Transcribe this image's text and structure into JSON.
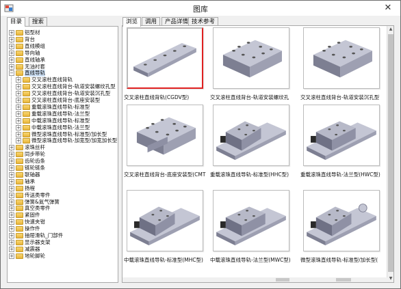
{
  "window": {
    "title": "图库"
  },
  "left_panel": {
    "tabs": [
      {
        "label": "目录",
        "active": true
      },
      {
        "label": "搜索",
        "active": false
      }
    ],
    "tree": [
      {
        "label": "铝型材",
        "level": 0,
        "expanded": false
      },
      {
        "label": "背台",
        "level": 0,
        "expanded": false
      },
      {
        "label": "直线模组",
        "level": 0,
        "expanded": false
      },
      {
        "label": "导向轴",
        "level": 0,
        "expanded": false
      },
      {
        "label": "直线轴承",
        "level": 0,
        "expanded": false
      },
      {
        "label": "无油衬套",
        "level": 0,
        "expanded": false
      },
      {
        "label": "直线导轨",
        "level": 0,
        "expanded": true
      },
      {
        "label": "交叉滚柱直线背轨",
        "level": 1,
        "expanded": false
      },
      {
        "label": "交叉滚柱直线背台-轨道安装螺纹孔型",
        "level": 1,
        "expanded": false
      },
      {
        "label": "交叉滚柱直线背台-轨道安装沉孔型",
        "level": 1,
        "expanded": false
      },
      {
        "label": "交叉滚柱直线背台-底座安装型",
        "level": 1,
        "expanded": false
      },
      {
        "label": "重载滚珠直线导轨-标准型",
        "level": 1,
        "expanded": false
      },
      {
        "label": "重载滚珠直线导轨-法兰型",
        "level": 1,
        "expanded": false
      },
      {
        "label": "中载滚珠直线导轨-标准型",
        "level": 1,
        "expanded": false
      },
      {
        "label": "中载滚珠直线导轨-法兰型",
        "level": 1,
        "expanded": false
      },
      {
        "label": "微型滚珠直线导轨-标准型/加长型",
        "level": 1,
        "expanded": false
      },
      {
        "label": "微型滚珠直线导轨-加宽型/加宽加长型",
        "level": 1,
        "expanded": false
      },
      {
        "label": "滚珠丝杆",
        "level": 0,
        "expanded": false
      },
      {
        "label": "同步带轮",
        "level": 0,
        "expanded": false
      },
      {
        "label": "齿轮齿条",
        "level": 0,
        "expanded": false
      },
      {
        "label": "链轮链条",
        "level": 0,
        "expanded": false
      },
      {
        "label": "联轴器",
        "level": 0,
        "expanded": false
      },
      {
        "label": "轴承",
        "level": 0,
        "expanded": false
      },
      {
        "label": "扬程",
        "level": 0,
        "expanded": false
      },
      {
        "label": "传送类零件",
        "level": 0,
        "expanded": false
      },
      {
        "label": "弹簧&氮气弹簧",
        "level": 0,
        "expanded": false
      },
      {
        "label": "真空类零件",
        "level": 0,
        "expanded": false
      },
      {
        "label": "紧固件",
        "level": 0,
        "expanded": false
      },
      {
        "label": "快速夹钳",
        "level": 0,
        "expanded": false
      },
      {
        "label": "操作件",
        "level": 0,
        "expanded": false
      },
      {
        "label": "抽屉滑轨_门部件",
        "level": 0,
        "expanded": false
      },
      {
        "label": "显示器支架",
        "level": 0,
        "expanded": false
      },
      {
        "label": "减震器",
        "level": 0,
        "expanded": false
      },
      {
        "label": "地轮脚轮",
        "level": 0,
        "expanded": false
      }
    ]
  },
  "right_panel": {
    "tabs": [
      {
        "label": "浏览",
        "active": true
      },
      {
        "label": "调用",
        "active": false
      },
      {
        "label": "产品详情",
        "active": false
      },
      {
        "label": "技术参考",
        "active": false
      }
    ],
    "items": [
      {
        "caption": "交叉滚柱直线背轨(CGDV型)",
        "icon": "cross-roller-rail-render",
        "selected": true
      },
      {
        "caption": "交叉滚柱直线背台-轨道安装螺纹孔",
        "icon": "cross-roller-table-threaded-render",
        "selected": false
      },
      {
        "caption": "交叉滚柱直线背台-轨道安装沉孔型",
        "icon": "cross-roller-table-counterbore-render",
        "selected": false
      },
      {
        "caption": "交叉滚柱直线背台-底座安装型(CMT",
        "icon": "cross-roller-table-base-mount-render",
        "selected": false
      },
      {
        "caption": "重载滚珠直线导轨-标准型(HHC型)",
        "icon": "heavy-ball-guide-standard-render",
        "selected": false
      },
      {
        "caption": "重载滚珠直线导轨-法兰型(HWC型)",
        "icon": "heavy-ball-guide-flange-render",
        "selected": false
      },
      {
        "caption": "中载滚珠直线导轨-标准型(MHC型)",
        "icon": "medium-ball-guide-standard-render",
        "selected": false
      },
      {
        "caption": "中载滚珠直线导轨-法兰型(MWC型)",
        "icon": "medium-ball-guide-flange-render",
        "selected": false
      },
      {
        "caption": "微型滚珠直线导轨-标准型/加长型(",
        "icon": "mini-ball-guide-render",
        "selected": false
      }
    ]
  },
  "colors": {
    "selection_border": "#e02020",
    "part_metal": "#9ea0b2",
    "tree_selection": "#cde0f5"
  }
}
